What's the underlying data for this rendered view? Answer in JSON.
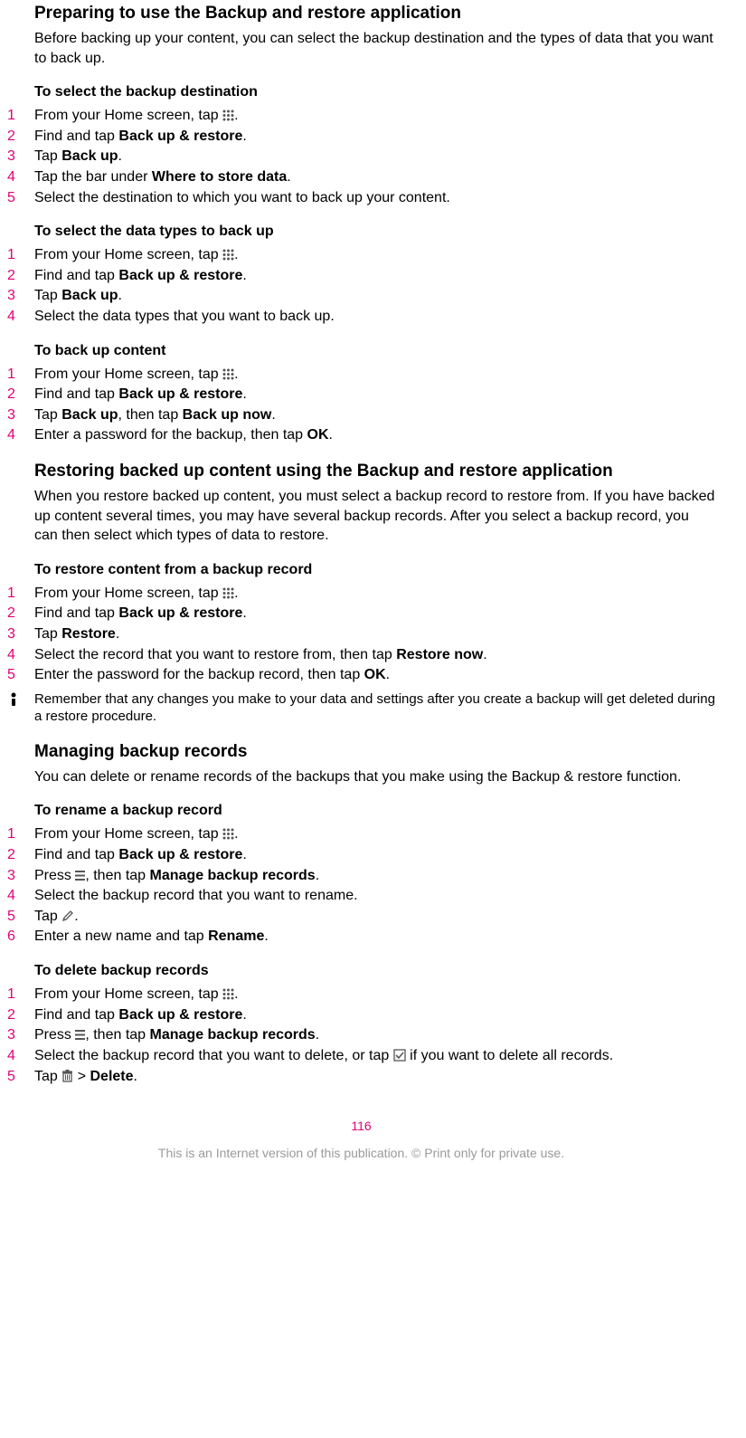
{
  "sec1": {
    "heading": "Preparing to use the Backup and restore application",
    "para": "Before backing up your content, you can select the backup destination and the types of data that you want to back up.",
    "sub1_h": "To select the backup destination",
    "sub1": {
      "s1a": "From your Home screen, tap ",
      "s1c": ".",
      "s2a": "Find and tap ",
      "s2b": "Back up & restore",
      "s2c": ".",
      "s3a": "Tap ",
      "s3b": "Back up",
      "s3c": ".",
      "s4a": "Tap the bar under ",
      "s4b": "Where to store data",
      "s4c": ".",
      "s5": "Select the destination to which you want to back up your content."
    },
    "sub2_h": "To select the data types to back up",
    "sub2": {
      "s1a": "From your Home screen, tap ",
      "s1c": ".",
      "s2a": "Find and tap ",
      "s2b": "Back up & restore",
      "s2c": ".",
      "s3a": "Tap ",
      "s3b": "Back up",
      "s3c": ".",
      "s4": "Select the data types that you want to back up."
    },
    "sub3_h": "To back up content",
    "sub3": {
      "s1a": "From your Home screen, tap ",
      "s1c": ".",
      "s2a": "Find and tap ",
      "s2b": "Back up & restore",
      "s2c": ".",
      "s3a": "Tap ",
      "s3b": "Back up",
      "s3c": ", then tap ",
      "s3d": "Back up now",
      "s3e": ".",
      "s4a": "Enter a password for the backup, then tap ",
      "s4b": "OK",
      "s4c": "."
    }
  },
  "sec2": {
    "heading": "Restoring backed up content using the Backup and restore application",
    "para": "When you restore backed up content, you must select a backup record to restore from. If you have backed up content several times, you may have several backup records. After you select a backup record, you can then select which types of data to restore.",
    "sub1_h": "To restore content from a backup record",
    "sub1": {
      "s1a": "From your Home screen, tap ",
      "s1c": ".",
      "s2a": "Find and tap ",
      "s2b": "Back up & restore",
      "s2c": ".",
      "s3a": "Tap ",
      "s3b": "Restore",
      "s3c": ".",
      "s4a": "Select the record that you want to restore from, then tap ",
      "s4b": "Restore now",
      "s4c": ".",
      "s5a": "Enter the password for the backup record, then tap ",
      "s5b": "OK",
      "s5c": "."
    },
    "note": "Remember that any changes you make to your data and settings after you create a backup will get deleted during a restore procedure."
  },
  "sec3": {
    "heading": "Managing backup records",
    "para": "You can delete or rename records of the backups that you make using the Backup & restore function.",
    "sub1_h": "To rename a backup record",
    "sub1": {
      "s1a": "From your Home screen, tap ",
      "s1c": ".",
      "s2a": "Find and tap ",
      "s2b": "Back up & restore",
      "s2c": ".",
      "s3a": "Press ",
      "s3c": ", then tap ",
      "s3d": "Manage backup records",
      "s3e": ".",
      "s4": "Select the backup record that you want to rename.",
      "s5a": "Tap ",
      "s5c": ".",
      "s6a": "Enter a new name and tap ",
      "s6b": "Rename",
      "s6c": "."
    },
    "sub2_h": "To delete backup records",
    "sub2": {
      "s1a": "From your Home screen, tap ",
      "s1c": ".",
      "s2a": "Find and tap ",
      "s2b": "Back up & restore",
      "s2c": ".",
      "s3a": "Press ",
      "s3c": ", then tap ",
      "s3d": "Manage backup records",
      "s3e": ".",
      "s4a": "Select the backup record that you want to delete, or tap ",
      "s4c": " if you want to delete all records.",
      "s5a": "Tap ",
      "s5c": " > ",
      "s5d": "Delete",
      "s5e": "."
    }
  },
  "page_num": "116",
  "footer": "This is an Internet version of this publication. © Print only for private use."
}
